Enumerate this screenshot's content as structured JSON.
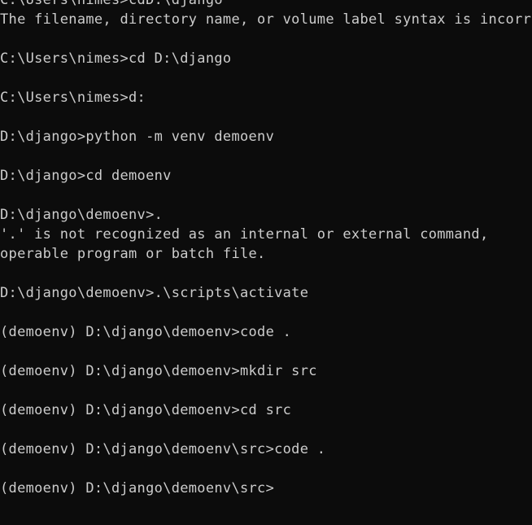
{
  "terminal": {
    "lines": [
      "C:\\Users\\nimes>cdD:\\django",
      "The filename, directory name, or volume label syntax is incorrect.",
      "",
      "C:\\Users\\nimes>cd D:\\django",
      "",
      "C:\\Users\\nimes>d:",
      "",
      "D:\\django>python -m venv demoenv",
      "",
      "D:\\django>cd demoenv",
      "",
      "D:\\django\\demoenv>.",
      "'.' is not recognized as an internal or external command,",
      "operable program or batch file.",
      "",
      "D:\\django\\demoenv>.\\scripts\\activate",
      "",
      "(demoenv) D:\\django\\demoenv>code .",
      "",
      "(demoenv) D:\\django\\demoenv>mkdir src",
      "",
      "(demoenv) D:\\django\\demoenv>cd src",
      "",
      "(demoenv) D:\\django\\demoenv\\src>code .",
      "",
      "(demoenv) D:\\django\\demoenv\\src>"
    ],
    "colors": {
      "background": "#0c0c0c",
      "text": "#cccccc"
    }
  }
}
